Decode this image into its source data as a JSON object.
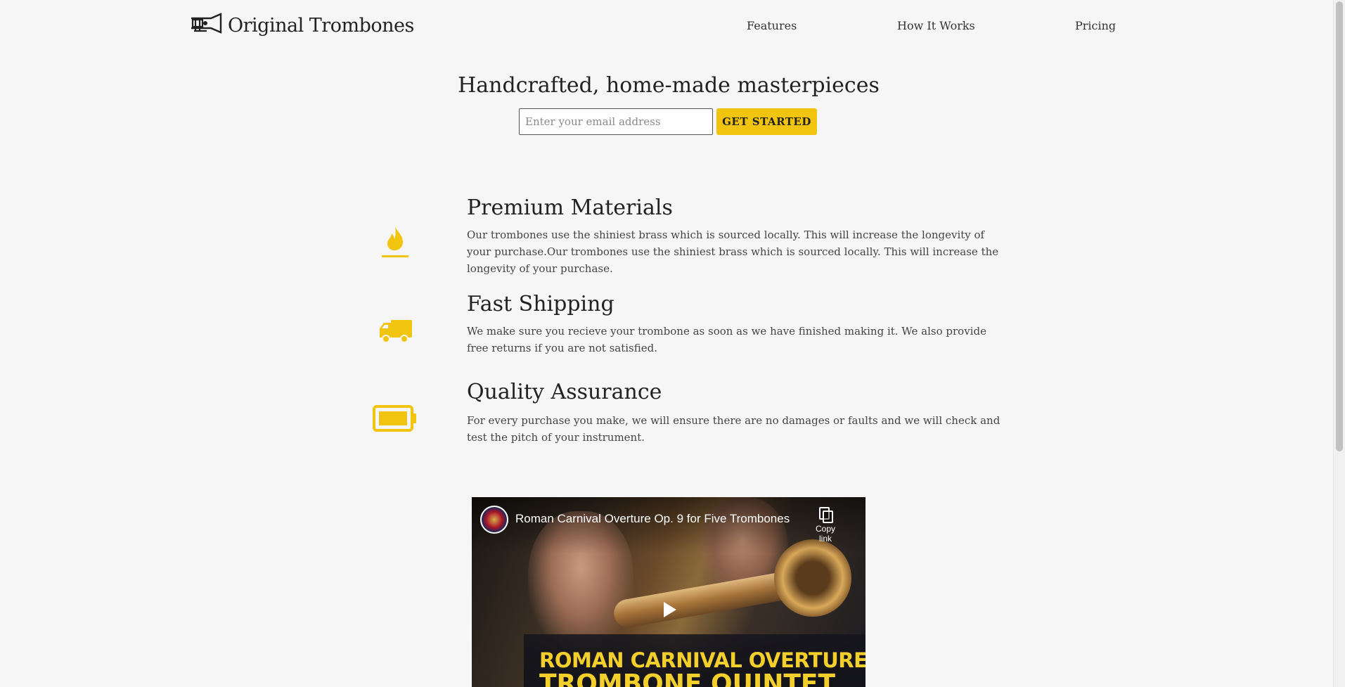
{
  "header": {
    "logo_text": "Original Trombones",
    "logo_icon": "trombone-icon",
    "nav": [
      {
        "label": "Features"
      },
      {
        "label": "How It Works"
      },
      {
        "label": "Pricing"
      }
    ]
  },
  "hero": {
    "title": "Handcrafted, home-made masterpieces",
    "email_placeholder": "Enter your email address",
    "cta_label": "GET STARTED"
  },
  "features": [
    {
      "icon": "fire-icon",
      "title": "Premium Materials",
      "text": "Our trombones use the shiniest brass which is sourced locally. This will increase the longevity of your purchase.Our trombones use the shiniest brass which is sourced locally. This will increase the longevity of your purchase."
    },
    {
      "icon": "truck-icon",
      "title": "Fast Shipping",
      "text": "We make sure you recieve your trombone as soon as we have finished making it. We also provide free returns if you are not satisfied."
    },
    {
      "icon": "battery-full-icon",
      "title": "Quality Assurance",
      "text": "For every purchase you make, we will ensure there are no damages or faults and we will check and test the pitch of your instrument."
    }
  ],
  "video": {
    "title": "Roman Carnival Overture Op. 9 for Five Trombones",
    "copy_link_label": "Copy link",
    "banner_line1": "ROMAN CARNIVAL OVERTURE",
    "banner_line2": "TROMBONE QUINTET"
  },
  "colors": {
    "accent": "#f1c40f",
    "background": "#f6f6f6"
  }
}
